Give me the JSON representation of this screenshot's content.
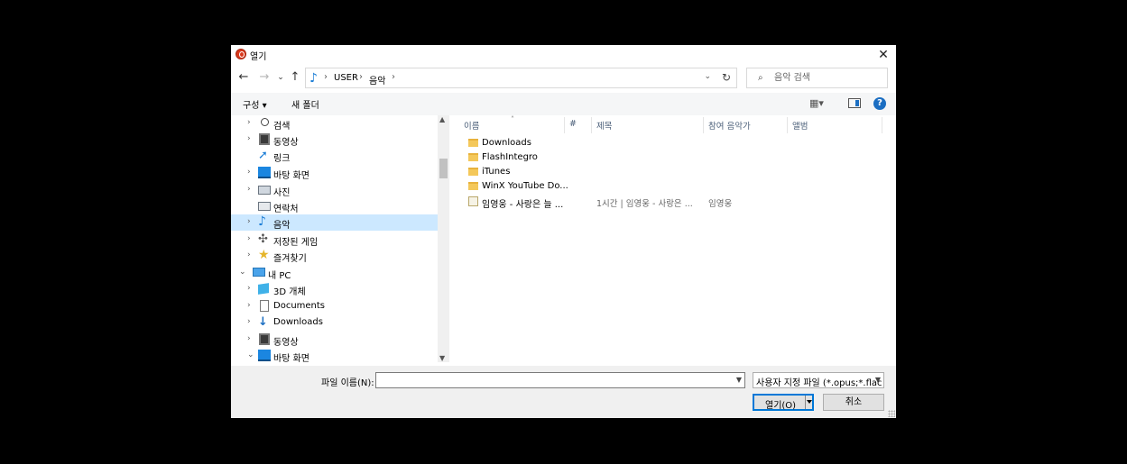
{
  "window": {
    "title": "열기",
    "close_symbol": "✕"
  },
  "nav": {
    "back": "←",
    "forward": "→",
    "recent": "⌄",
    "up": "↑",
    "address": {
      "crumbs": [
        "USER",
        "음악"
      ],
      "separator": "›",
      "dropdown": "⌄"
    },
    "refresh": "↻",
    "search": {
      "icon": "⌕",
      "placeholder": "음악 검색"
    }
  },
  "toolbar": {
    "organize": "구성 ▾",
    "new_folder": "새 폴더",
    "view": "▦▾",
    "help": "?"
  },
  "tree": {
    "items": [
      {
        "label": "검색",
        "icon": "search-icon",
        "chevron": "›"
      },
      {
        "label": "동영상",
        "icon": "film-icon",
        "chevron": "›"
      },
      {
        "label": "링크",
        "icon": "link-icon",
        "chevron": ""
      },
      {
        "label": "바탕 화면",
        "icon": "desktop-icon",
        "chevron": "›"
      },
      {
        "label": "사진",
        "icon": "photo-icon",
        "chevron": "›"
      },
      {
        "label": "연락처",
        "icon": "contact-icon",
        "chevron": ""
      },
      {
        "label": "음악",
        "icon": "music-icon",
        "chevron": "›",
        "selected": true
      },
      {
        "label": "저장된 게임",
        "icon": "game-icon",
        "chevron": "›"
      },
      {
        "label": "즐겨찾기",
        "icon": "star-icon",
        "chevron": "›"
      },
      {
        "label": "내 PC",
        "icon": "pc-icon",
        "chevron": "⌄"
      },
      {
        "label": "3D 개체",
        "icon": "3d-objects-icon",
        "chevron": "›"
      },
      {
        "label": "Documents",
        "icon": "documents-icon",
        "chevron": "›"
      },
      {
        "label": "Downloads",
        "icon": "downloads-icon",
        "chevron": "›"
      },
      {
        "label": "동영상",
        "icon": "film-icon",
        "chevron": "›"
      },
      {
        "label": "바탕 화면",
        "icon": "desktop-icon",
        "chevron": "⌄"
      }
    ]
  },
  "file_list": {
    "columns": [
      "이름",
      "#",
      "제목",
      "참여 음악가",
      "앨범"
    ],
    "sort_indicator": "˄",
    "rows": [
      {
        "name": "Downloads",
        "type": "folder",
        "number": "",
        "title": "",
        "artist": ""
      },
      {
        "name": "FlashIntegro",
        "type": "folder",
        "number": "",
        "title": "",
        "artist": ""
      },
      {
        "name": "iTunes",
        "type": "folder",
        "number": "",
        "title": "",
        "artist": ""
      },
      {
        "name": "WinX YouTube Do...",
        "type": "folder",
        "number": "",
        "title": "",
        "artist": ""
      },
      {
        "name": "임영웅 - 사랑은 늘 ...",
        "type": "media",
        "number": "",
        "title": "1시간 | 임영웅 - 사랑은 ...",
        "artist": "임영웅"
      }
    ]
  },
  "footer": {
    "filename_label": "파일 이름(N):",
    "filename_value": "",
    "filetype": "사용자 지정 파일 (*.opus;*.flac",
    "open_label": "열기(O)",
    "cancel_label": "취소"
  },
  "colors": {
    "selection": "#cce8ff",
    "accent": "#0078d7",
    "folder": "#f4c85a"
  }
}
